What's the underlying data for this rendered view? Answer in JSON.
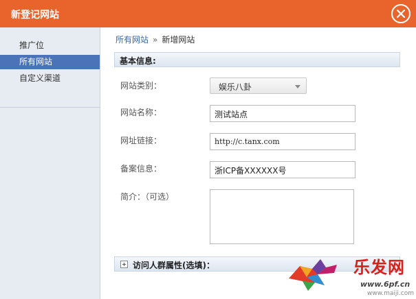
{
  "dialog": {
    "title": "新登记网站"
  },
  "sidebar": {
    "items": [
      {
        "label": "推广位"
      },
      {
        "label": "所有网站"
      },
      {
        "label": "自定义渠道"
      }
    ]
  },
  "breadcrumb": {
    "parent": "所有网站",
    "separator": "»",
    "current": "新增网站"
  },
  "basic_section": {
    "title": "基本信息:"
  },
  "form": {
    "category_label": "网站类别：",
    "category_value": "娱乐八卦",
    "name_label": "网站名称：",
    "name_value": "测试站点",
    "url_label": "网址链接：",
    "url_value": "http://c.tanx.com",
    "record_label": "备案信息：",
    "record_value": "浙ICP备XXXXXX号",
    "intro_label": "简介：（可选）",
    "intro_value": ""
  },
  "audience_section": {
    "title": "访问人群属性(选填)："
  },
  "watermark": {
    "brand": "乐发网",
    "url": "www.6pf.cn",
    "url2": "www.maiji.com"
  },
  "colors": {
    "titlebar": "#e9642c",
    "sidebar_active": "#4b73b8",
    "link": "#3a66a8"
  }
}
